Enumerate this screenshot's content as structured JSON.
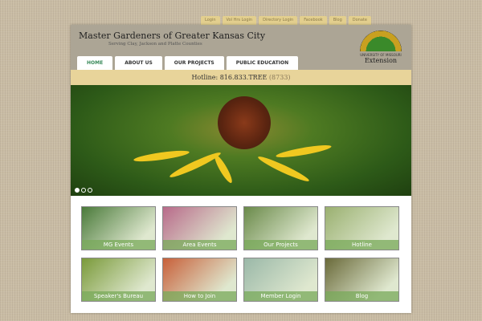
{
  "top_links": [
    "Login",
    "Vol Hrs Login",
    "Directory Login",
    "Facebook",
    "Blog",
    "Donate"
  ],
  "header": {
    "title": "Master Gardeners of Greater Kansas City",
    "subtitle": "Serving Clay, Jackson and Platte Counties",
    "logo_university": "UNIVERSITY OF MISSOURI",
    "logo_extension": "Extension"
  },
  "nav": [
    {
      "label": "HOME"
    },
    {
      "label": "ABOUT US"
    },
    {
      "label": "OUR PROJECTS"
    },
    {
      "label": "PUBLIC EDUCATION"
    }
  ],
  "hotline": {
    "label": "Hotline: 816.833.TREE",
    "number": "(8733)"
  },
  "slider": {
    "slides": 3,
    "active": 0
  },
  "tiles": [
    {
      "label": "MG Events",
      "color": "#4a7a3a"
    },
    {
      "label": "Area Events",
      "color": "#b86a8a"
    },
    {
      "label": "Our Projects",
      "color": "#6a8a4a"
    },
    {
      "label": "Hotline",
      "color": "#9ab070"
    },
    {
      "label": "Speaker's Bureau",
      "color": "#7a9a3a"
    },
    {
      "label": "How to Join",
      "color": "#c8603a"
    },
    {
      "label": "Member Login",
      "color": "#9ab8a8"
    },
    {
      "label": "Blog",
      "color": "#6a6a3a"
    }
  ]
}
